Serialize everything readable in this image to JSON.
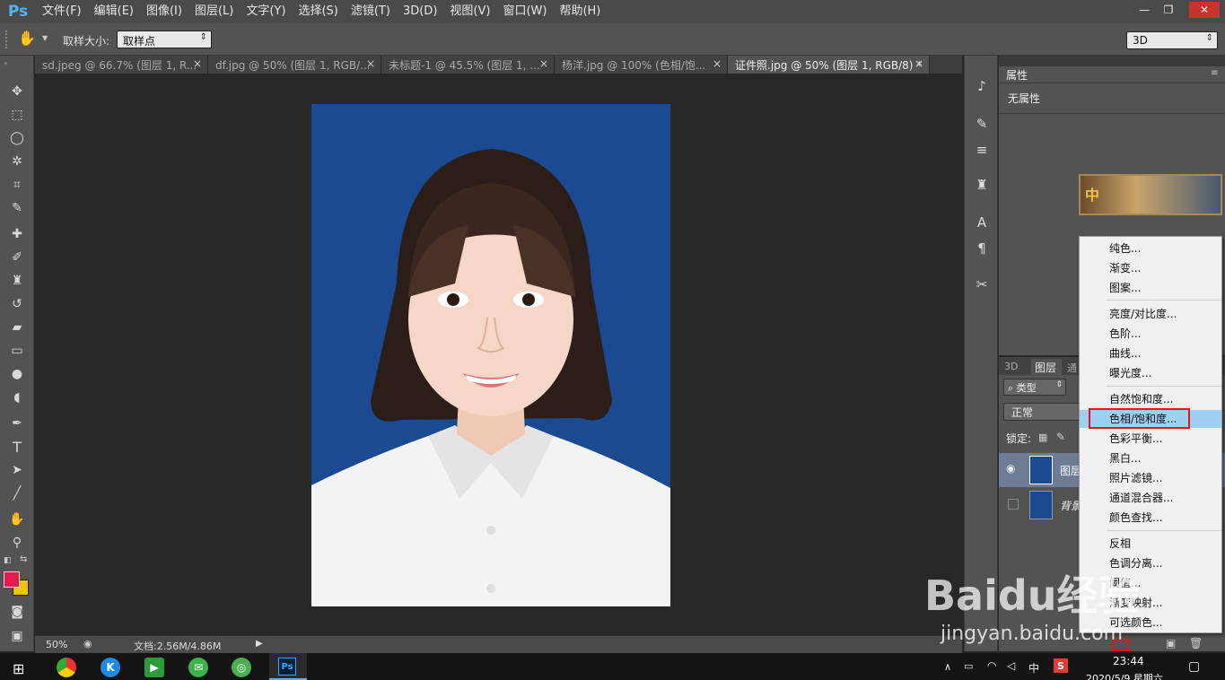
{
  "app": {
    "logo": "Ps"
  },
  "menu": [
    "文件(F)",
    "编辑(E)",
    "图像(I)",
    "图层(L)",
    "文字(Y)",
    "选择(S)",
    "滤镜(T)",
    "3D(D)",
    "视图(V)",
    "窗口(W)",
    "帮助(H)"
  ],
  "window_buttons": {
    "minimize": "—",
    "restore": "❐",
    "close": "✕"
  },
  "options": {
    "sample_size_label": "取样大小:",
    "sample_size_value": "取样点",
    "workspace": "3D"
  },
  "tabs": [
    {
      "label": "sd.jpeg @ 66.7% (图层 1, R..."
    },
    {
      "label": "df.jpg @ 50% (图层 1, RGB/..."
    },
    {
      "label": "未标题-1 @ 45.5% (图层 1, ..."
    },
    {
      "label": "杨洋.jpg @ 100% (色相/饱..."
    },
    {
      "label": "证件照.jpg @ 50% (图层 1, RGB/8) *"
    }
  ],
  "tab_close": "×",
  "status": {
    "zoom": "50%",
    "doc": "文档:2.56M/4.86M"
  },
  "properties": {
    "title": "属性",
    "content": "无属性"
  },
  "layers_panel": {
    "tabs": [
      "3D",
      "图层",
      "通"
    ],
    "filter": "类型",
    "blend": "正常",
    "lock_label": "锁定:",
    "layers": [
      {
        "name": "图层"
      },
      {
        "name": "背景"
      }
    ]
  },
  "dropdown": {
    "items": [
      "纯色...",
      "渐变...",
      "图案...",
      "亮度/对比度...",
      "色阶...",
      "曲线...",
      "曝光度...",
      "自然饱和度...",
      "色相/饱和度...",
      "色彩平衡...",
      "黑白...",
      "照片滤镜...",
      "通道混合器...",
      "颜色查找...",
      "反相",
      "色调分离...",
      "阈值...",
      "渐变映射...",
      "可选颜色..."
    ],
    "highlighted": "色相/饱和度..."
  },
  "taskbar": {
    "time": "23:44",
    "date": "2020/5/9 星期六",
    "ime": "中",
    "ps": "Ps"
  },
  "watermark": {
    "brand": "Baidu经验",
    "url": "jingyan.baidu.com"
  },
  "colors": {
    "foreground": "#e8194f",
    "background": "#f5c400",
    "photo_bg": "#1b4a90",
    "accent": "#55b3f0"
  }
}
